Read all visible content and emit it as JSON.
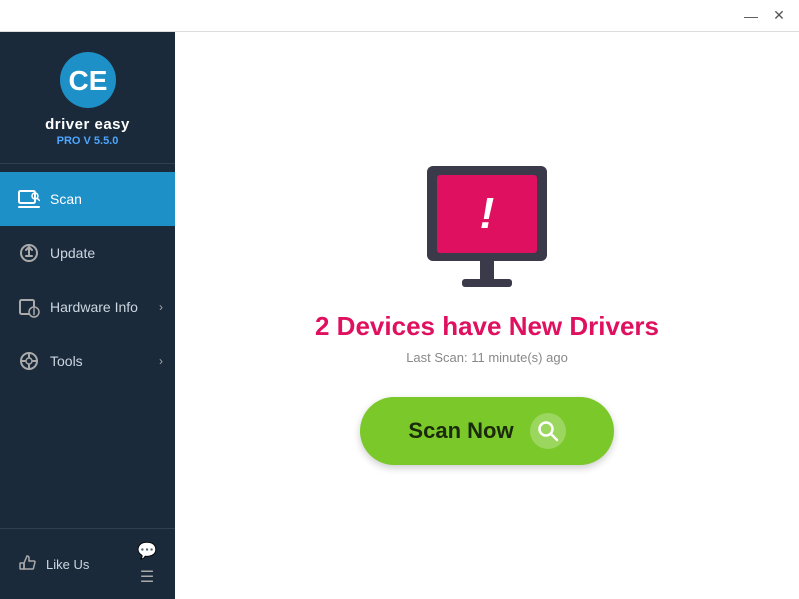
{
  "titlebar": {
    "minimize_label": "—",
    "close_label": "✕"
  },
  "sidebar": {
    "logo_alt": "Driver Easy Logo",
    "app_name": "driver easy",
    "app_version": "PRO V 5.5.0",
    "nav_items": [
      {
        "id": "scan",
        "label": "Scan",
        "active": true,
        "has_chevron": false
      },
      {
        "id": "update",
        "label": "Update",
        "active": false,
        "has_chevron": false
      },
      {
        "id": "hardware-info",
        "label": "Hardware Info",
        "active": false,
        "has_chevron": true
      },
      {
        "id": "tools",
        "label": "Tools",
        "active": false,
        "has_chevron": true
      }
    ],
    "footer": {
      "like_label": "Like Us"
    }
  },
  "main": {
    "headline": "2 Devices have New Drivers",
    "subtext": "Last Scan: 11 minute(s) ago",
    "scan_button_label": "Scan Now"
  }
}
